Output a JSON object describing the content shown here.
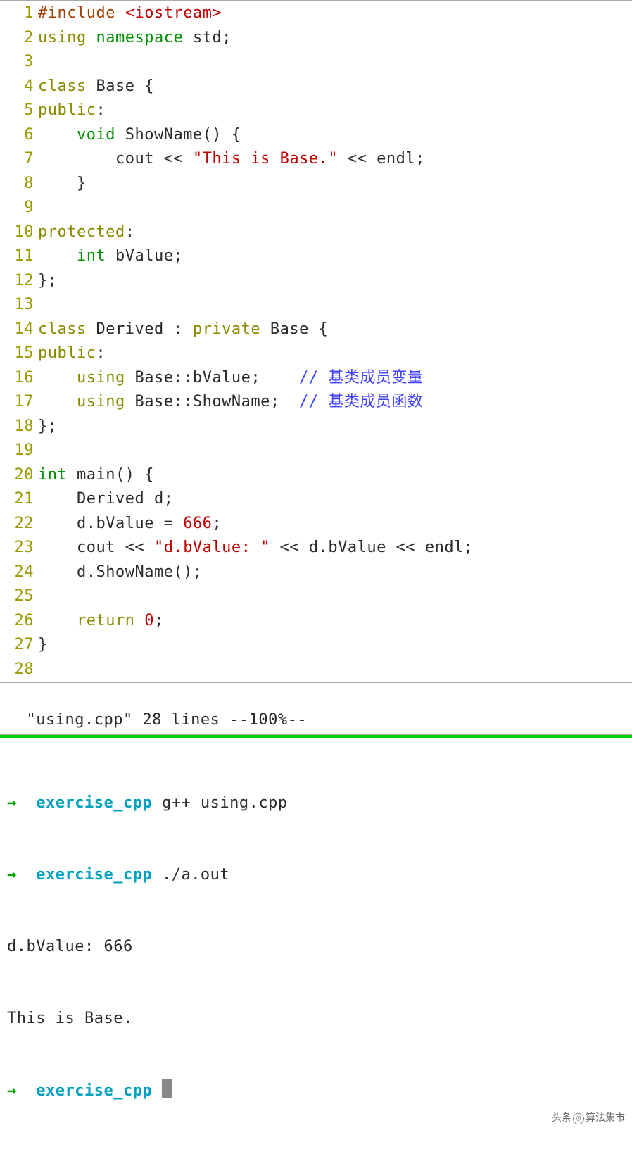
{
  "code": {
    "lines": [
      {
        "n": "1",
        "tokens": [
          {
            "c": "preproc",
            "t": "#include "
          },
          {
            "c": "hdr",
            "t": "<iostream>"
          }
        ]
      },
      {
        "n": "2",
        "tokens": [
          {
            "c": "kw-using",
            "t": "using"
          },
          {
            "c": "plain",
            "t": " "
          },
          {
            "c": "kw-ns",
            "t": "namespace"
          },
          {
            "c": "plain",
            "t": " std;"
          }
        ]
      },
      {
        "n": "3",
        "tokens": []
      },
      {
        "n": "4",
        "tokens": [
          {
            "c": "kw-class",
            "t": "class"
          },
          {
            "c": "plain",
            "t": " Base {"
          }
        ]
      },
      {
        "n": "5",
        "tokens": [
          {
            "c": "kw-access",
            "t": "public"
          },
          {
            "c": "plain",
            "t": ":"
          }
        ]
      },
      {
        "n": "6",
        "tokens": [
          {
            "c": "plain",
            "t": "    "
          },
          {
            "c": "type",
            "t": "void"
          },
          {
            "c": "plain",
            "t": " ShowName() {"
          }
        ]
      },
      {
        "n": "7",
        "tokens": [
          {
            "c": "plain",
            "t": "        cout << "
          },
          {
            "c": "str",
            "t": "\"This is Base.\""
          },
          {
            "c": "plain",
            "t": " << endl;"
          }
        ]
      },
      {
        "n": "8",
        "tokens": [
          {
            "c": "plain",
            "t": "    }"
          }
        ]
      },
      {
        "n": "9",
        "tokens": []
      },
      {
        "n": "10",
        "tokens": [
          {
            "c": "kw-access",
            "t": "protected"
          },
          {
            "c": "plain",
            "t": ":"
          }
        ]
      },
      {
        "n": "11",
        "tokens": [
          {
            "c": "plain",
            "t": "    "
          },
          {
            "c": "type",
            "t": "int"
          },
          {
            "c": "plain",
            "t": " bValue;"
          }
        ]
      },
      {
        "n": "12",
        "tokens": [
          {
            "c": "plain",
            "t": "};"
          }
        ]
      },
      {
        "n": "13",
        "tokens": []
      },
      {
        "n": "14",
        "tokens": [
          {
            "c": "kw-class",
            "t": "class"
          },
          {
            "c": "plain",
            "t": " Derived : "
          },
          {
            "c": "kw-priv",
            "t": "private"
          },
          {
            "c": "plain",
            "t": " Base {"
          }
        ]
      },
      {
        "n": "15",
        "tokens": [
          {
            "c": "kw-access",
            "t": "public"
          },
          {
            "c": "plain",
            "t": ":"
          }
        ]
      },
      {
        "n": "16",
        "tokens": [
          {
            "c": "plain",
            "t": "    "
          },
          {
            "c": "kw-using",
            "t": "using"
          },
          {
            "c": "plain",
            "t": " Base::bValue;    "
          },
          {
            "c": "cmt",
            "t": "// 基类成员变量"
          }
        ]
      },
      {
        "n": "17",
        "tokens": [
          {
            "c": "plain",
            "t": "    "
          },
          {
            "c": "kw-using",
            "t": "using"
          },
          {
            "c": "plain",
            "t": " Base::ShowName;  "
          },
          {
            "c": "cmt",
            "t": "// 基类成员函数"
          }
        ]
      },
      {
        "n": "18",
        "tokens": [
          {
            "c": "plain",
            "t": "};"
          }
        ]
      },
      {
        "n": "19",
        "tokens": []
      },
      {
        "n": "20",
        "tokens": [
          {
            "c": "type",
            "t": "int"
          },
          {
            "c": "plain",
            "t": " main() {"
          }
        ]
      },
      {
        "n": "21",
        "tokens": [
          {
            "c": "plain",
            "t": "    Derived d;"
          }
        ]
      },
      {
        "n": "22",
        "tokens": [
          {
            "c": "plain",
            "t": "    d.bValue = "
          },
          {
            "c": "num",
            "t": "666"
          },
          {
            "c": "plain",
            "t": ";"
          }
        ]
      },
      {
        "n": "23",
        "tokens": [
          {
            "c": "plain",
            "t": "    cout << "
          },
          {
            "c": "str",
            "t": "\"d.bValue: \""
          },
          {
            "c": "plain",
            "t": " << d.bValue << endl;"
          }
        ]
      },
      {
        "n": "24",
        "tokens": [
          {
            "c": "plain",
            "t": "    d.ShowName();"
          }
        ]
      },
      {
        "n": "25",
        "tokens": []
      },
      {
        "n": "26",
        "tokens": [
          {
            "c": "plain",
            "t": "    "
          },
          {
            "c": "kw-return",
            "t": "return"
          },
          {
            "c": "plain",
            "t": " "
          },
          {
            "c": "num",
            "t": "0"
          },
          {
            "c": "plain",
            "t": ";"
          }
        ]
      },
      {
        "n": "27",
        "tokens": [
          {
            "c": "plain",
            "t": "}"
          }
        ]
      },
      {
        "n": "28",
        "tokens": []
      }
    ]
  },
  "status": {
    "text": "\"using.cpp\" 28 lines --100%--"
  },
  "terminal": {
    "prompt_arrow": "→",
    "cwd": "exercise_cpp",
    "cmd1": "g++ using.cpp",
    "cmd2": "./a.out",
    "out1": "d.bValue: 666",
    "out2": "This is Base."
  },
  "watermark": {
    "prefix": "头条",
    "suffix": "算法集市"
  }
}
